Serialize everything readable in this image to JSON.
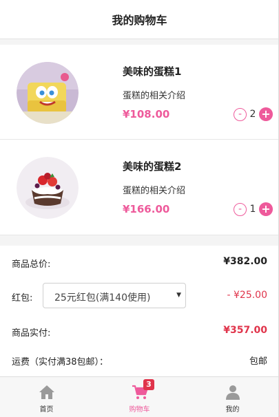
{
  "header": {
    "title": "我的购物车"
  },
  "cart": {
    "items": [
      {
        "name": "美味的蛋糕1",
        "desc": "蛋糕的相关介绍",
        "price": "¥108.00",
        "qty": "2",
        "minus": "-",
        "plus": "+"
      },
      {
        "name": "美味的蛋糕2",
        "desc": "蛋糕的相关介绍",
        "price": "¥166.00",
        "qty": "1",
        "minus": "-",
        "plus": "+"
      }
    ]
  },
  "summary": {
    "total_label": "商品总价:",
    "total_value": "¥382.00",
    "redpacket_label": "红包:",
    "redpacket_selected": "25元红包(满140使用)",
    "redpacket_discount": "- ¥25.00",
    "paid_label": "商品实付:",
    "paid_value": "¥357.00",
    "shipping_label": "运费（实付满38包邮）：",
    "shipping_value": "包邮"
  },
  "tabbar": {
    "items": [
      {
        "label": "首页",
        "icon": "home-icon"
      },
      {
        "label": "购物车",
        "icon": "cart-icon",
        "badge": "3"
      },
      {
        "label": "我的",
        "icon": "user-icon"
      }
    ]
  },
  "colors": {
    "accent": "#ee5a9b",
    "price_red": "#e0344b",
    "tab_icon_gray": "#9a9a9a"
  }
}
